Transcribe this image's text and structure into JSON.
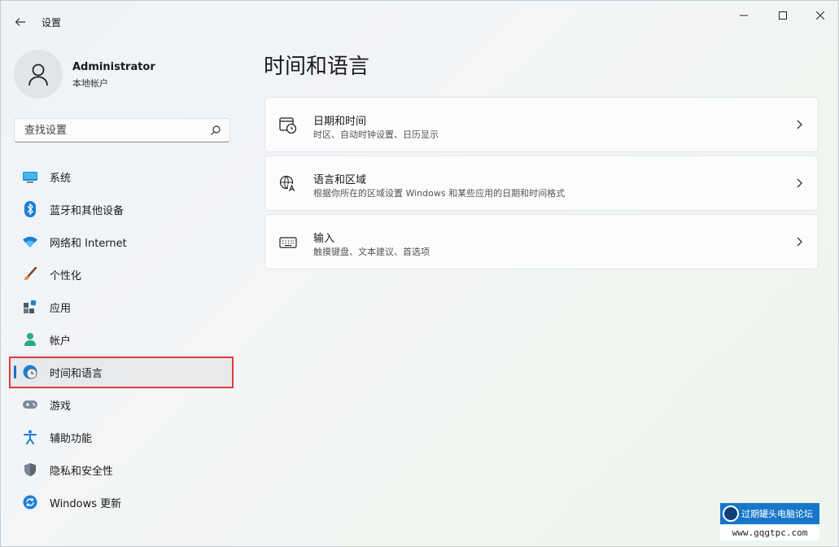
{
  "window": {
    "title": "设置"
  },
  "account": {
    "name": "Administrator",
    "type": "本地帐户"
  },
  "search": {
    "placeholder": "查找设置"
  },
  "nav": {
    "items": [
      {
        "label": "系统",
        "icon": "monitor-icon"
      },
      {
        "label": "蓝牙和其他设备",
        "icon": "bluetooth-icon"
      },
      {
        "label": "网络和 Internet",
        "icon": "wifi-icon"
      },
      {
        "label": "个性化",
        "icon": "brush-icon"
      },
      {
        "label": "应用",
        "icon": "apps-icon"
      },
      {
        "label": "帐户",
        "icon": "person-icon"
      },
      {
        "label": "时间和语言",
        "icon": "globe-clock-icon",
        "active": true
      },
      {
        "label": "游戏",
        "icon": "gamepad-icon"
      },
      {
        "label": "辅助功能",
        "icon": "accessibility-icon"
      },
      {
        "label": "隐私和安全性",
        "icon": "shield-icon"
      },
      {
        "label": "Windows 更新",
        "icon": "update-icon"
      }
    ]
  },
  "main": {
    "title": "时间和语言",
    "cards": [
      {
        "title": "日期和时间",
        "subtitle": "时区、自动时钟设置、日历显示",
        "icon": "calendar-clock-icon"
      },
      {
        "title": "语言和区域",
        "subtitle": "根据你所在的区域设置 Windows 和某些应用的日期和时间格式",
        "icon": "language-icon"
      },
      {
        "title": "输入",
        "subtitle": "触摸键盘、文本建议、首选项",
        "icon": "keyboard-icon"
      }
    ]
  },
  "watermark": {
    "name": "过期罐头电脑论坛",
    "url": "www.gqgtpc.com"
  },
  "colors": {
    "accent": "#1a6fc4",
    "highlight_box": "#e03b3b"
  }
}
